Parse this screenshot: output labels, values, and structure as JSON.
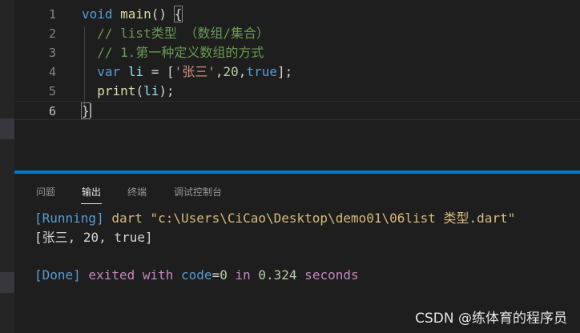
{
  "editor": {
    "lines": [
      {
        "num": "1",
        "tokens": [
          {
            "t": "void",
            "c": "kw"
          },
          {
            "t": " ",
            "c": ""
          },
          {
            "t": "main",
            "c": "fn"
          },
          {
            "t": "() ",
            "c": ""
          },
          {
            "t": "{",
            "c": "brace"
          }
        ]
      },
      {
        "num": "2",
        "tokens": [
          {
            "t": "  // list类型 （数组/集合）",
            "c": "cmt"
          }
        ]
      },
      {
        "num": "3",
        "tokens": [
          {
            "t": "  // 1.第一种定义数组的方式",
            "c": "cmt"
          }
        ]
      },
      {
        "num": "4",
        "tokens": [
          {
            "t": "  ",
            "c": ""
          },
          {
            "t": "var",
            "c": "kw"
          },
          {
            "t": " ",
            "c": ""
          },
          {
            "t": "li",
            "c": "var"
          },
          {
            "t": " = [",
            "c": ""
          },
          {
            "t": "'张三'",
            "c": "str"
          },
          {
            "t": ",",
            "c": ""
          },
          {
            "t": "20",
            "c": "num"
          },
          {
            "t": ",",
            "c": ""
          },
          {
            "t": "true",
            "c": "kw"
          },
          {
            "t": "];",
            "c": ""
          }
        ]
      },
      {
        "num": "5",
        "tokens": [
          {
            "t": "  ",
            "c": ""
          },
          {
            "t": "print",
            "c": "fn"
          },
          {
            "t": "(",
            "c": ""
          },
          {
            "t": "li",
            "c": "var"
          },
          {
            "t": ");",
            "c": ""
          }
        ]
      },
      {
        "num": "6",
        "tokens": [
          {
            "t": "}",
            "c": "brace"
          }
        ],
        "current": true
      }
    ]
  },
  "panel": {
    "tabs": [
      {
        "label": "问题",
        "active": false
      },
      {
        "label": "输出",
        "active": true
      },
      {
        "label": "终端",
        "active": false
      },
      {
        "label": "调试控制台",
        "active": false
      }
    ],
    "output": {
      "line1": {
        "tag": "[Running]",
        "rest": " dart \"c:\\Users\\CiCao\\Desktop\\demo01\\06list 类型.dart\""
      },
      "line2": "[张三, 20, true]",
      "line3": {
        "tag": "[Done]",
        "exited": " exited with ",
        "code": "code",
        "eq": "=",
        "zero": "0",
        "in": " in ",
        "time": "0.324",
        "seconds": " seconds"
      }
    }
  },
  "watermark": "CSDN @练体育的程序员"
}
